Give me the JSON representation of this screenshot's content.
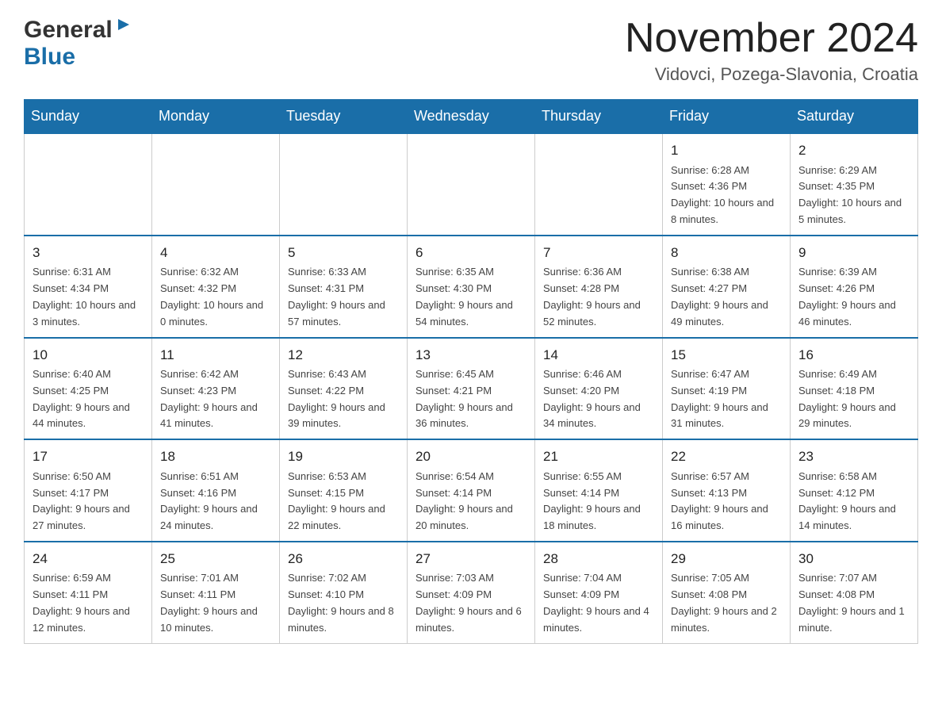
{
  "header": {
    "logo_general": "General",
    "logo_blue": "Blue",
    "month_year": "November 2024",
    "location": "Vidovci, Pozega-Slavonia, Croatia"
  },
  "calendar": {
    "days_of_week": [
      "Sunday",
      "Monday",
      "Tuesday",
      "Wednesday",
      "Thursday",
      "Friday",
      "Saturday"
    ],
    "weeks": [
      {
        "days": [
          {
            "number": "",
            "info": ""
          },
          {
            "number": "",
            "info": ""
          },
          {
            "number": "",
            "info": ""
          },
          {
            "number": "",
            "info": ""
          },
          {
            "number": "",
            "info": ""
          },
          {
            "number": "1",
            "info": "Sunrise: 6:28 AM\nSunset: 4:36 PM\nDaylight: 10 hours and 8 minutes."
          },
          {
            "number": "2",
            "info": "Sunrise: 6:29 AM\nSunset: 4:35 PM\nDaylight: 10 hours and 5 minutes."
          }
        ]
      },
      {
        "days": [
          {
            "number": "3",
            "info": "Sunrise: 6:31 AM\nSunset: 4:34 PM\nDaylight: 10 hours and 3 minutes."
          },
          {
            "number": "4",
            "info": "Sunrise: 6:32 AM\nSunset: 4:32 PM\nDaylight: 10 hours and 0 minutes."
          },
          {
            "number": "5",
            "info": "Sunrise: 6:33 AM\nSunset: 4:31 PM\nDaylight: 9 hours and 57 minutes."
          },
          {
            "number": "6",
            "info": "Sunrise: 6:35 AM\nSunset: 4:30 PM\nDaylight: 9 hours and 54 minutes."
          },
          {
            "number": "7",
            "info": "Sunrise: 6:36 AM\nSunset: 4:28 PM\nDaylight: 9 hours and 52 minutes."
          },
          {
            "number": "8",
            "info": "Sunrise: 6:38 AM\nSunset: 4:27 PM\nDaylight: 9 hours and 49 minutes."
          },
          {
            "number": "9",
            "info": "Sunrise: 6:39 AM\nSunset: 4:26 PM\nDaylight: 9 hours and 46 minutes."
          }
        ]
      },
      {
        "days": [
          {
            "number": "10",
            "info": "Sunrise: 6:40 AM\nSunset: 4:25 PM\nDaylight: 9 hours and 44 minutes."
          },
          {
            "number": "11",
            "info": "Sunrise: 6:42 AM\nSunset: 4:23 PM\nDaylight: 9 hours and 41 minutes."
          },
          {
            "number": "12",
            "info": "Sunrise: 6:43 AM\nSunset: 4:22 PM\nDaylight: 9 hours and 39 minutes."
          },
          {
            "number": "13",
            "info": "Sunrise: 6:45 AM\nSunset: 4:21 PM\nDaylight: 9 hours and 36 minutes."
          },
          {
            "number": "14",
            "info": "Sunrise: 6:46 AM\nSunset: 4:20 PM\nDaylight: 9 hours and 34 minutes."
          },
          {
            "number": "15",
            "info": "Sunrise: 6:47 AM\nSunset: 4:19 PM\nDaylight: 9 hours and 31 minutes."
          },
          {
            "number": "16",
            "info": "Sunrise: 6:49 AM\nSunset: 4:18 PM\nDaylight: 9 hours and 29 minutes."
          }
        ]
      },
      {
        "days": [
          {
            "number": "17",
            "info": "Sunrise: 6:50 AM\nSunset: 4:17 PM\nDaylight: 9 hours and 27 minutes."
          },
          {
            "number": "18",
            "info": "Sunrise: 6:51 AM\nSunset: 4:16 PM\nDaylight: 9 hours and 24 minutes."
          },
          {
            "number": "19",
            "info": "Sunrise: 6:53 AM\nSunset: 4:15 PM\nDaylight: 9 hours and 22 minutes."
          },
          {
            "number": "20",
            "info": "Sunrise: 6:54 AM\nSunset: 4:14 PM\nDaylight: 9 hours and 20 minutes."
          },
          {
            "number": "21",
            "info": "Sunrise: 6:55 AM\nSunset: 4:14 PM\nDaylight: 9 hours and 18 minutes."
          },
          {
            "number": "22",
            "info": "Sunrise: 6:57 AM\nSunset: 4:13 PM\nDaylight: 9 hours and 16 minutes."
          },
          {
            "number": "23",
            "info": "Sunrise: 6:58 AM\nSunset: 4:12 PM\nDaylight: 9 hours and 14 minutes."
          }
        ]
      },
      {
        "days": [
          {
            "number": "24",
            "info": "Sunrise: 6:59 AM\nSunset: 4:11 PM\nDaylight: 9 hours and 12 minutes."
          },
          {
            "number": "25",
            "info": "Sunrise: 7:01 AM\nSunset: 4:11 PM\nDaylight: 9 hours and 10 minutes."
          },
          {
            "number": "26",
            "info": "Sunrise: 7:02 AM\nSunset: 4:10 PM\nDaylight: 9 hours and 8 minutes."
          },
          {
            "number": "27",
            "info": "Sunrise: 7:03 AM\nSunset: 4:09 PM\nDaylight: 9 hours and 6 minutes."
          },
          {
            "number": "28",
            "info": "Sunrise: 7:04 AM\nSunset: 4:09 PM\nDaylight: 9 hours and 4 minutes."
          },
          {
            "number": "29",
            "info": "Sunrise: 7:05 AM\nSunset: 4:08 PM\nDaylight: 9 hours and 2 minutes."
          },
          {
            "number": "30",
            "info": "Sunrise: 7:07 AM\nSunset: 4:08 PM\nDaylight: 9 hours and 1 minute."
          }
        ]
      }
    ]
  }
}
